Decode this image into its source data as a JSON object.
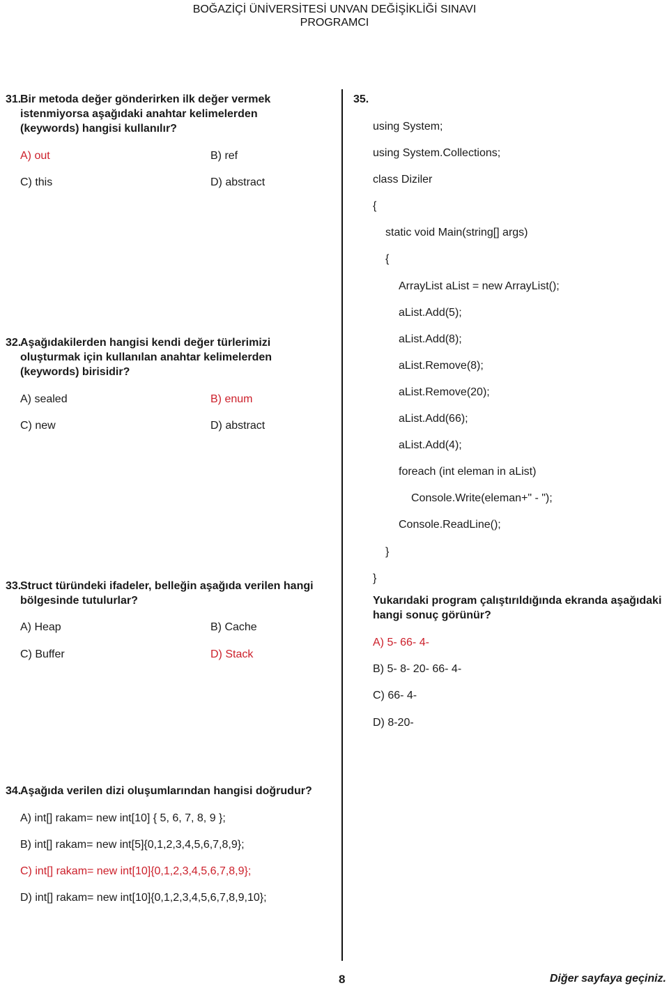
{
  "header": {
    "line1": "BOĞAZİÇİ ÜNİVERSİTESİ UNVAN DEĞİŞİKLİĞİ SINAVI",
    "line2": "PROGRAMCI"
  },
  "questions": {
    "q31": {
      "number": "31.",
      "text_lines": [
        "Bir metoda değer gönderirken ilk değer vermek",
        "istenmiyorsa aşağıdaki anahtar kelimelerden",
        "(keywords)  hangisi kullanılır?"
      ],
      "options": [
        {
          "label": "A) out",
          "correct": true
        },
        {
          "label": "B) ref",
          "correct": false
        },
        {
          "label": "C) this",
          "correct": false
        },
        {
          "label": "D) abstract",
          "correct": false
        }
      ]
    },
    "q32": {
      "number": "32.",
      "text_lines": [
        "Aşağıdakilerden hangisi kendi değer türlerimizi",
        "oluşturmak için kullanılan anahtar kelimelerden",
        "(keywords) birisidir?"
      ],
      "options": [
        {
          "label": "A) sealed",
          "correct": false
        },
        {
          "label": "B) enum",
          "correct": true
        },
        {
          "label": "C) new",
          "correct": false
        },
        {
          "label": "D) abstract",
          "correct": false
        }
      ]
    },
    "q33": {
      "number": "33.",
      "text_lines": [
        "Struct türündeki ifadeler, belleğin aşağıda verilen hangi",
        "bölgesinde tutulurlar?"
      ],
      "options": [
        {
          "label": "A) Heap",
          "correct": false
        },
        {
          "label": "B) Cache",
          "correct": false
        },
        {
          "label": "C) Buffer",
          "correct": false
        },
        {
          "label": "D) Stack",
          "correct": true
        }
      ]
    },
    "q34": {
      "number": "34.",
      "text": "Aşağıda verilen dizi oluşumlarından hangisi doğrudur?",
      "options": [
        {
          "label": "A) int[] rakam= new int[10] { 5, 6, 7, 8, 9 };",
          "correct": false
        },
        {
          "label": "B) int[] rakam= new int[5]{0,1,2,3,4,5,6,7,8,9};",
          "correct": false
        },
        {
          "label": "C) int[] rakam= new int[10]{0,1,2,3,4,5,6,7,8,9};",
          "correct": true
        },
        {
          "label": "D) int[] rakam= new int[10]{0,1,2,3,4,5,6,7,8,9,10};",
          "correct": false
        }
      ]
    },
    "q35": {
      "number": "35.",
      "code_lines": [
        "using System;",
        "using System.Collections;",
        "class Diziler",
        "{",
        "static void Main(string[] args)",
        "{",
        "ArrayList aList = new ArrayList();",
        "aList.Add(5);",
        "aList.Add(8);",
        "aList.Remove(8);",
        "aList.Remove(20);",
        "aList.Add(66);",
        "aList.Add(4);",
        "foreach (int eleman in aList)",
        "Console.Write(eleman+\" - \");",
        "Console.ReadLine();",
        "}",
        "}"
      ],
      "text_lines": [
        "Yukarıdaki program çalıştırıldığında ekranda aşağıdaki",
        "hangi sonuç görünür?"
      ],
      "options": [
        {
          "label": "A) 5- 66- 4-",
          "correct": true
        },
        {
          "label": "B) 5- 8- 20- 66- 4-",
          "correct": false
        },
        {
          "label": "C) 66- 4-",
          "correct": false
        },
        {
          "label": "D) 8-20-",
          "correct": false
        }
      ]
    }
  },
  "footer": {
    "page_number": "8",
    "next_page_text": "Diğer sayfaya geçiniz."
  },
  "colors": {
    "correct_answer": "#cc1f2a",
    "text": "#1a1a1a"
  }
}
